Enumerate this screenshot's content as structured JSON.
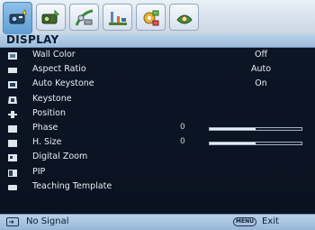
{
  "tabs": [
    {
      "icon": "display-tab-icon",
      "active": true
    },
    {
      "icon": "picture-tab-icon",
      "active": false
    },
    {
      "icon": "source-tab-icon",
      "active": false
    },
    {
      "icon": "system-setup-tab-icon",
      "active": false
    },
    {
      "icon": "advanced-tab-icon",
      "active": false
    },
    {
      "icon": "information-tab-icon",
      "active": false
    }
  ],
  "header": {
    "title": "DISPLAY"
  },
  "menu": {
    "items": [
      {
        "label": "Wall Color",
        "value": "Off"
      },
      {
        "label": "Aspect Ratio",
        "value": "Auto"
      },
      {
        "label": "Auto Keystone",
        "value": "On"
      },
      {
        "label": "Keystone"
      },
      {
        "label": "Position"
      },
      {
        "label": "Phase",
        "number": "0",
        "level": 0.5
      },
      {
        "label": "H. Size",
        "number": "0",
        "level": 0.5
      },
      {
        "label": "Digital Zoom"
      },
      {
        "label": "PIP"
      },
      {
        "label": "Teaching Template"
      }
    ]
  },
  "footer": {
    "status": "No Signal",
    "menu_button": "MENU",
    "exit": "Exit"
  },
  "colors": {
    "background": "#0a1220",
    "header": "#9dbcdc",
    "text": "#e8edf4",
    "active_tab": "#5f9fd4"
  }
}
